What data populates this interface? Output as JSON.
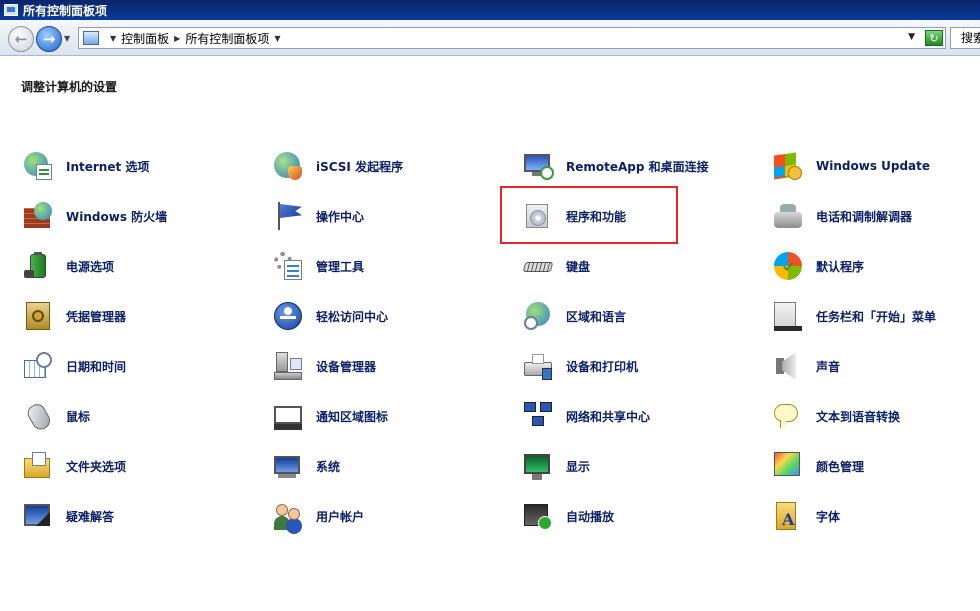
{
  "window": {
    "title": "所有控制面板项"
  },
  "address_bar": {
    "crumbs": [
      "控制面板",
      "所有控制面板项"
    ],
    "search_placeholder": "搜索"
  },
  "page": {
    "heading": "调整计算机的设置"
  },
  "items": [
    {
      "label": "Internet 选项",
      "icon": "internet-options-icon",
      "col": 0,
      "row": 0
    },
    {
      "label": "iSCSI 发起程序",
      "icon": "iscsi-initiator-icon",
      "col": 1,
      "row": 0
    },
    {
      "label": "RemoteApp 和桌面连接",
      "icon": "remoteapp-icon",
      "col": 2,
      "row": 0
    },
    {
      "label": "Windows Update",
      "icon": "windows-update-icon",
      "col": 3,
      "row": 0
    },
    {
      "label": "Windows 防火墙",
      "icon": "firewall-icon",
      "col": 0,
      "row": 1
    },
    {
      "label": "操作中心",
      "icon": "action-center-flag-icon",
      "col": 1,
      "row": 1
    },
    {
      "label": "程序和功能",
      "icon": "programs-features-icon",
      "col": 2,
      "row": 1
    },
    {
      "label": "电话和调制解调器",
      "icon": "phone-modem-icon",
      "col": 3,
      "row": 1
    },
    {
      "label": "电源选项",
      "icon": "power-options-icon",
      "col": 0,
      "row": 2
    },
    {
      "label": "管理工具",
      "icon": "admin-tools-icon",
      "col": 1,
      "row": 2
    },
    {
      "label": "键盘",
      "icon": "keyboard-icon",
      "col": 2,
      "row": 2
    },
    {
      "label": "默认程序",
      "icon": "default-programs-icon",
      "col": 3,
      "row": 2
    },
    {
      "label": "凭据管理器",
      "icon": "credential-manager-icon",
      "col": 0,
      "row": 3
    },
    {
      "label": "轻松访问中心",
      "icon": "ease-of-access-icon",
      "col": 1,
      "row": 3
    },
    {
      "label": "区域和语言",
      "icon": "region-language-icon",
      "col": 2,
      "row": 3
    },
    {
      "label": "任务栏和「开始」菜单",
      "icon": "taskbar-start-menu-icon",
      "col": 3,
      "row": 3
    },
    {
      "label": "日期和时间",
      "icon": "date-time-icon",
      "col": 0,
      "row": 4
    },
    {
      "label": "设备管理器",
      "icon": "device-manager-icon",
      "col": 1,
      "row": 4
    },
    {
      "label": "设备和打印机",
      "icon": "devices-printers-icon",
      "col": 2,
      "row": 4
    },
    {
      "label": "声音",
      "icon": "sound-icon",
      "col": 3,
      "row": 4
    },
    {
      "label": "鼠标",
      "icon": "mouse-icon",
      "col": 0,
      "row": 5
    },
    {
      "label": "通知区域图标",
      "icon": "notification-area-icon",
      "col": 1,
      "row": 5
    },
    {
      "label": "网络和共享中心",
      "icon": "network-sharing-icon",
      "col": 2,
      "row": 5
    },
    {
      "label": "文本到语音转换",
      "icon": "text-to-speech-icon",
      "col": 3,
      "row": 5
    },
    {
      "label": "文件夹选项",
      "icon": "folder-options-icon",
      "col": 0,
      "row": 6
    },
    {
      "label": "系统",
      "icon": "system-icon",
      "col": 1,
      "row": 6
    },
    {
      "label": "显示",
      "icon": "display-icon",
      "col": 2,
      "row": 6
    },
    {
      "label": "颜色管理",
      "icon": "color-management-icon",
      "col": 3,
      "row": 6
    },
    {
      "label": "疑难解答",
      "icon": "troubleshooting-icon",
      "col": 0,
      "row": 7
    },
    {
      "label": "用户帐户",
      "icon": "user-accounts-icon",
      "col": 1,
      "row": 7
    },
    {
      "label": "自动播放",
      "icon": "autoplay-icon",
      "col": 2,
      "row": 7
    },
    {
      "label": "字体",
      "icon": "fonts-icon",
      "col": 3,
      "row": 7
    }
  ],
  "colors": {
    "link": "#0b1f66",
    "highlight_box": "#e8242c",
    "titlebar": "#0a246a"
  }
}
